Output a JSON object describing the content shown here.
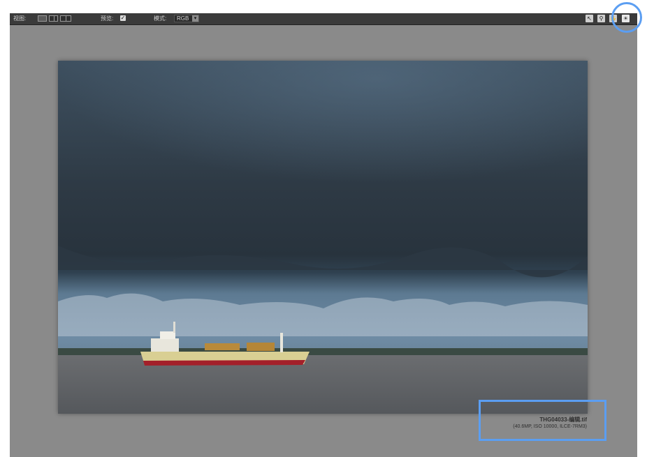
{
  "toolbar": {
    "view_label": "视图:",
    "preview_label": "预览:",
    "preview_checked": true,
    "mode_label": "模式:",
    "mode_value": "RGB",
    "view_buttons": [
      "single-view-icon",
      "side-by-side-view-icon",
      "split-view-icon"
    ],
    "tools": [
      "pointer-icon",
      "zoom-icon",
      "hand-icon",
      "light-icon"
    ]
  },
  "image_info": {
    "filename": "THG04033-编辑.tif",
    "details": "(40.6MP, ISO 10000, ILCE-7RM3)"
  },
  "colors": {
    "highlight": "#5b9ef2",
    "canvas": "#8a8a8a",
    "toolbar": "#3b3b3b"
  }
}
